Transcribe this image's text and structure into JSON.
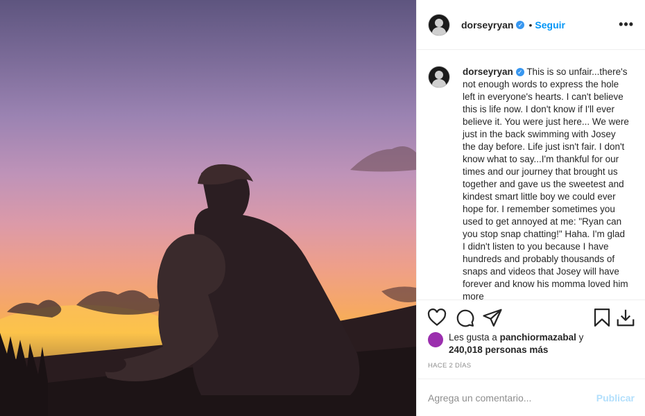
{
  "post": {
    "username": "dorseyryan",
    "follow_label": "Seguir",
    "more_label": "•••",
    "caption": "This is so unfair...there's not enough words to express the hole left in everyone's hearts. I can't believe this is life now. I don't know if I'll ever believe it. You were just here... We were just in the back swimming with Josey the day before. Life just isn't fair. I don't know what to say...I'm thankful for our times and our journey that brought us together and gave us the sweetest and kindest smart little boy we could ever hope for. I remember sometimes you used to get annoyed at me: \"Ryan can you stop snap chatting!\" Haha. I'm glad I didn't listen to you because I have hundreds and probably thousands of snaps and videos that Josey will have forever and know his momma loved him more"
  },
  "likes": {
    "prefix": "Les gusta a",
    "user": "panchiormazabal",
    "connector": "y",
    "count": "240,018 personas más"
  },
  "time_label": "HACE 2 DÍAS",
  "comment": {
    "placeholder": "Agrega un comentario...",
    "publish_label": "Publicar"
  },
  "icons": [
    "heart-icon",
    "comment-icon",
    "share-icon",
    "bookmark-icon",
    "download-icon",
    "verified-icon"
  ],
  "colors": {
    "accent": "#0095f6",
    "verified": "#3897f0",
    "publish_disabled": "#b2dffc"
  }
}
